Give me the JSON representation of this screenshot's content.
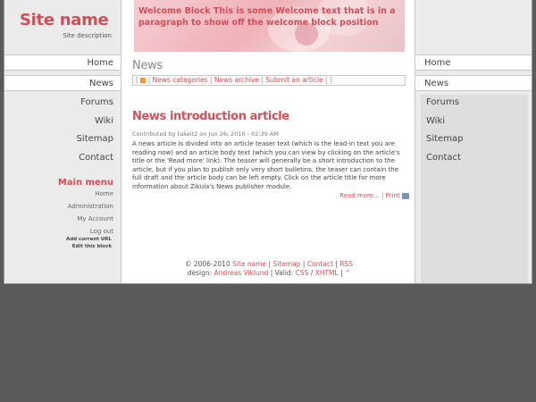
{
  "site": {
    "name": "Site name",
    "description": "Site description"
  },
  "left_nav": {
    "main_items": [
      "Home",
      "News"
    ],
    "sub_items": [
      "Forums",
      "Wiki",
      "Sitemap",
      "Contact"
    ]
  },
  "main_menu": {
    "title": "Main menu",
    "items": [
      "Home",
      "Administration",
      "My Account",
      "Log out"
    ],
    "small_links": [
      "Add current URL",
      "Edit this block"
    ]
  },
  "welcome": {
    "text": "Welcome Block This is some Welcome text that is in a paragraph to show off the welcome block position"
  },
  "news": {
    "heading": "News",
    "bar": {
      "open": "[",
      "close": "]",
      "sep": "|",
      "categories": "News categories",
      "archive": "News archive",
      "submit": "Submit an article",
      "rss_icon": "rss-icon"
    }
  },
  "article": {
    "title": "News introduction article",
    "meta": "Contributed by takeit2 on Jun 26, 2010 - 02:39 AM",
    "body": "A news article is divided into an article teaser text (which is the lead-in text you are reading now) and an article body text (which you can view by clicking on the article's title or the 'Read more' link). The teaser will generally be a short introduction to the article, but if you plan to publish only very short bulletins, the teaser can contain the full draft and the article body can be left empty. Click on the article title for more information about Zikula's News publisher module.",
    "read_more": "Read more...",
    "print": "Print"
  },
  "footer": {
    "copyright": "© 2006-2010",
    "site_link": "Site name",
    "sitemap": "Sitemap",
    "contact": "Contact",
    "rss": "RSS",
    "design_label": "design:",
    "designer": "Andreas Viklund",
    "valid_label": "Valid:",
    "css": "CSS",
    "xhtml": "XHTML",
    "top": "^"
  },
  "right_nav": {
    "main_items": [
      "Home",
      "News"
    ],
    "sub_items": [
      "Forums",
      "Wiki",
      "Sitemap",
      "Contact"
    ]
  },
  "colors": {
    "accent": "#d0505a",
    "background": "#5a5a5a",
    "sidebar": "#ebebeb"
  }
}
